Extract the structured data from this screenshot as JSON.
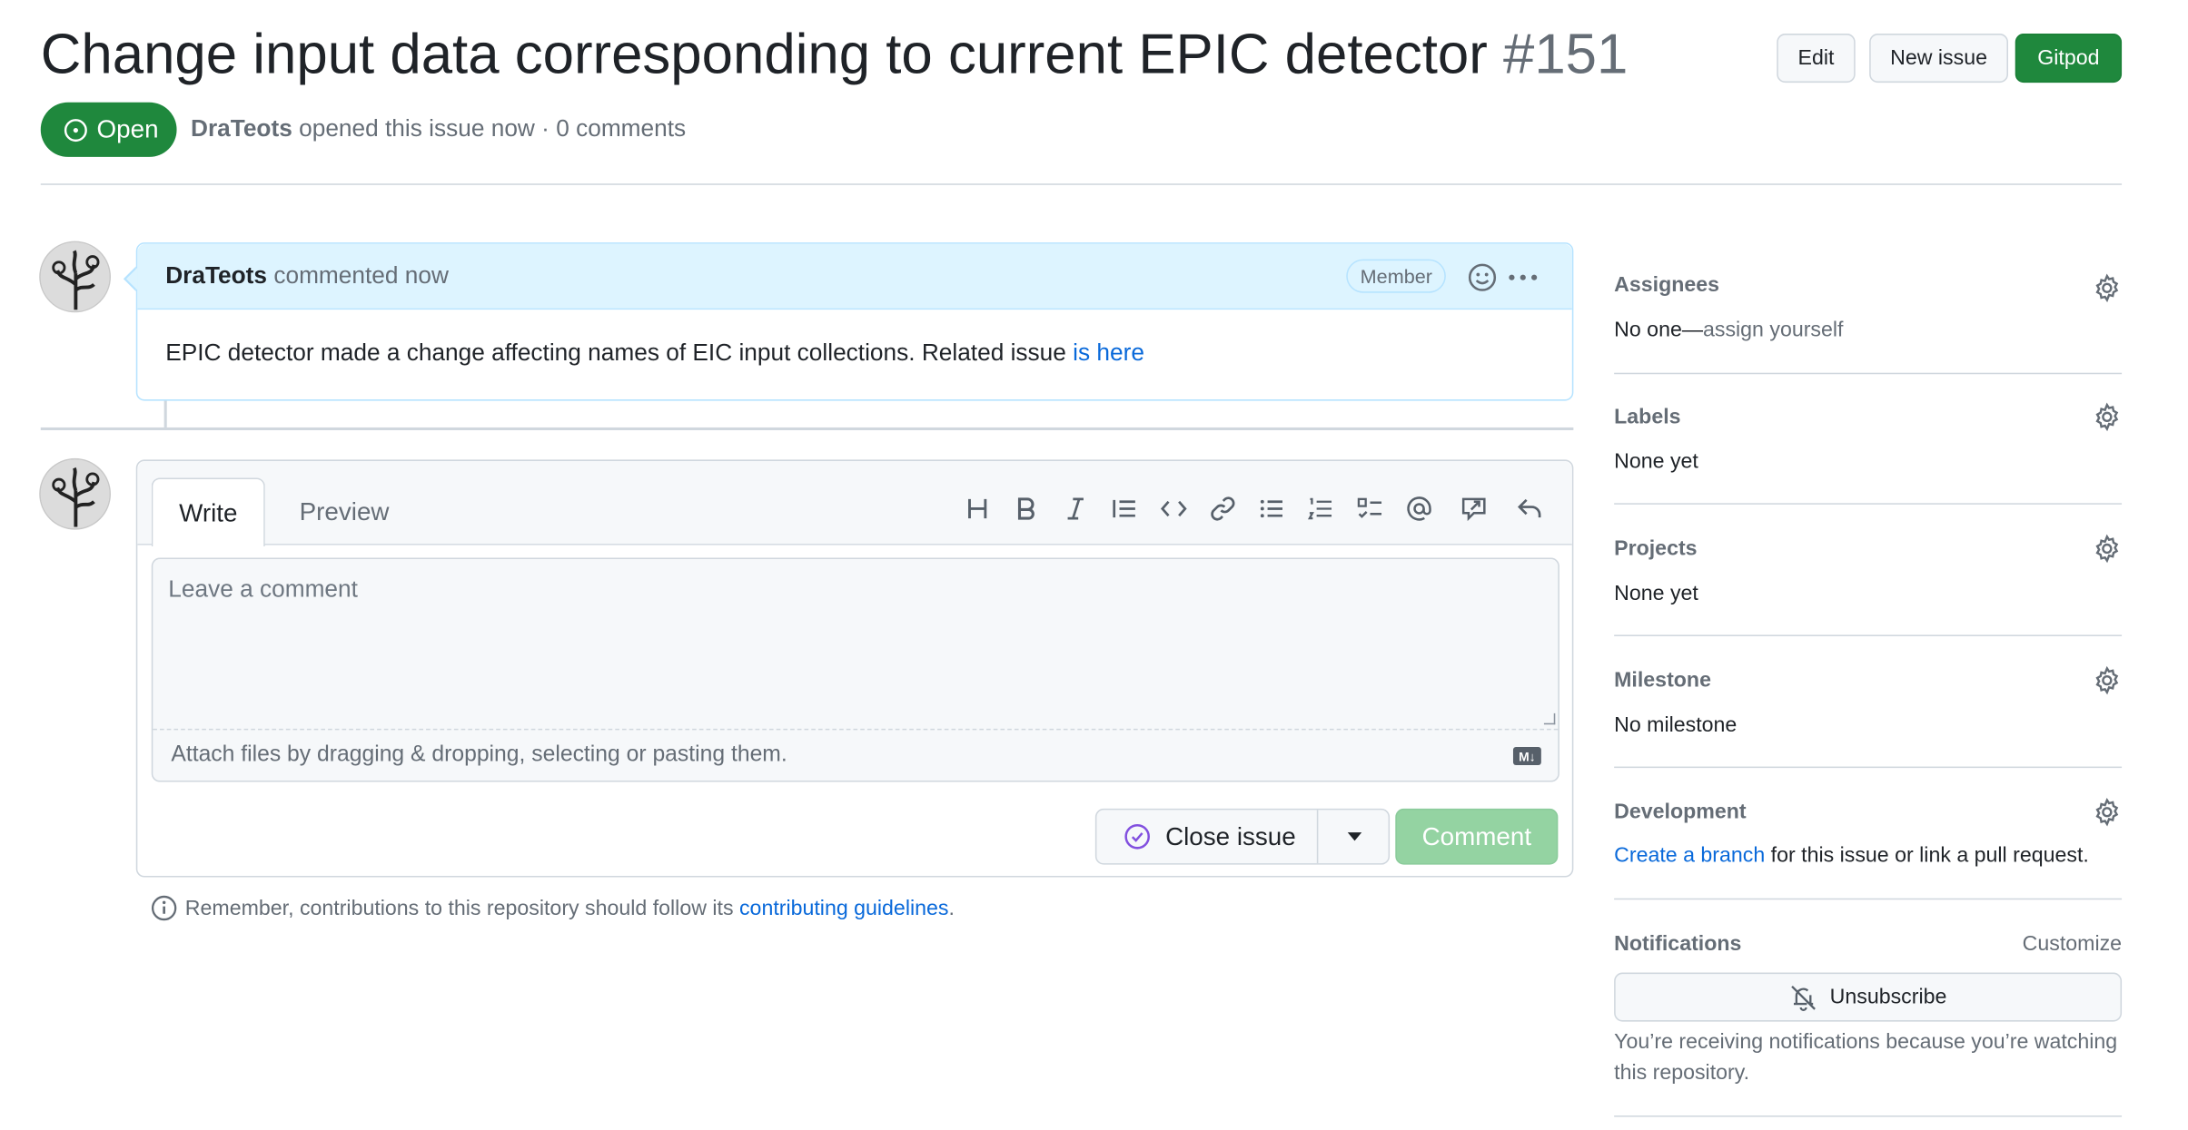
{
  "header": {
    "title": "Change input data corresponding to current EPIC detector",
    "number": "#151",
    "edit_label": "Edit",
    "new_issue_label": "New issue",
    "gitpod_label": "Gitpod",
    "state": "Open",
    "author": "DraTeots",
    "meta_text": "opened this issue now · 0 comments"
  },
  "comment": {
    "author": "DraTeots",
    "time": "commented now",
    "badge": "Member",
    "body": "EPIC detector made a change affecting names of EIC input collections. Related issue",
    "link_text": "is here"
  },
  "editor": {
    "tab_write": "Write",
    "tab_preview": "Preview",
    "placeholder": "Leave a comment",
    "attach_text": "Attach files by dragging & dropping, selecting or pasting them.",
    "markdown_badge": "M↓",
    "close_label": "Close issue",
    "comment_label": "Comment",
    "toolbar": [
      "heading-icon",
      "bold-icon",
      "italic-icon",
      "quote-icon",
      "code-icon",
      "link-icon",
      "unordered-list-icon",
      "ordered-list-icon",
      "task-list-icon",
      "mention-icon",
      "reference-icon",
      "reply-icon"
    ]
  },
  "remember": {
    "text": "Remember, contributions to this repository should follow its",
    "link": "contributing guidelines",
    "end": "."
  },
  "sidebar": {
    "assignees": {
      "title": "Assignees",
      "value_a": "No one—",
      "value_b": "assign yourself"
    },
    "labels": {
      "title": "Labels",
      "value": "None yet"
    },
    "projects": {
      "title": "Projects",
      "value": "None yet"
    },
    "milestone": {
      "title": "Milestone",
      "value": "No milestone"
    },
    "development": {
      "title": "Development",
      "link": "Create a branch",
      "rest": "for this issue or link a pull request."
    },
    "notifications": {
      "title": "Notifications",
      "customize": "Customize",
      "unsubscribe": "Unsubscribe",
      "note": "You’re receiving notifications because you’re watching this repository."
    }
  },
  "colors": {
    "accent_green": "#1f883d",
    "link_blue": "#0969da",
    "comment_header_bg": "#ddf4ff",
    "close_issue_purple": "#8250df"
  }
}
